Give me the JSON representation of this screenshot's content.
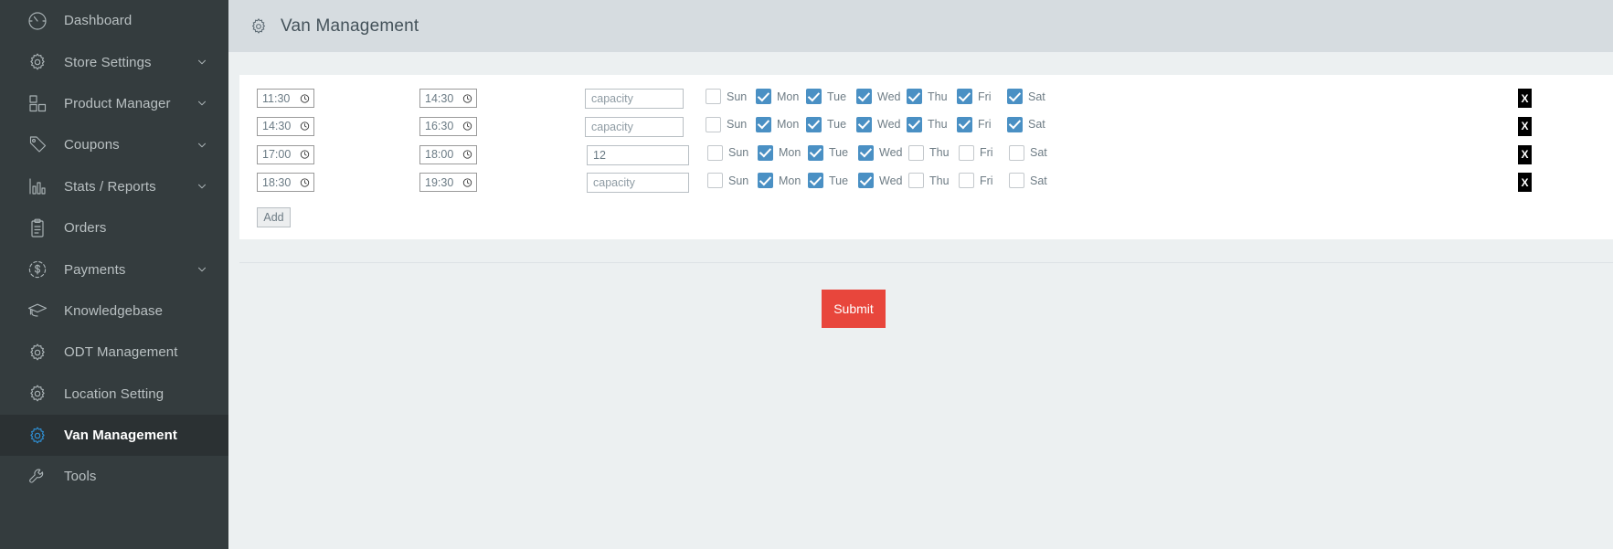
{
  "sidebar": {
    "items": [
      {
        "label": "Dashboard",
        "icon": "speedometer-icon",
        "chevron": false,
        "active": false
      },
      {
        "label": "Store Settings",
        "icon": "gear-icon",
        "chevron": true,
        "active": false
      },
      {
        "label": "Product Manager",
        "icon": "blocks-icon",
        "chevron": true,
        "active": false
      },
      {
        "label": "Coupons",
        "icon": "tag-icon",
        "chevron": true,
        "active": false
      },
      {
        "label": "Stats / Reports",
        "icon": "bar-chart-icon",
        "chevron": true,
        "active": false
      },
      {
        "label": "Orders",
        "icon": "clipboard-icon",
        "chevron": false,
        "active": false
      },
      {
        "label": "Payments",
        "icon": "dollar-circle-icon",
        "chevron": true,
        "active": false
      },
      {
        "label": "Knowledgebase",
        "icon": "graduation-cap-icon",
        "chevron": false,
        "active": false
      },
      {
        "label": "ODT Management",
        "icon": "gear-icon",
        "chevron": false,
        "active": false
      },
      {
        "label": "Location Setting",
        "icon": "gear-icon",
        "chevron": false,
        "active": false
      },
      {
        "label": "Van Management",
        "icon": "gear-icon",
        "chevron": false,
        "active": true
      },
      {
        "label": "Tools",
        "icon": "wrench-icon",
        "chevron": false,
        "active": false
      }
    ]
  },
  "header": {
    "title": "Van Management",
    "icon": "gear-icon"
  },
  "form": {
    "capacity_placeholder": "capacity",
    "day_labels": [
      "Sun",
      "Mon",
      "Tue",
      "Wed",
      "Thu",
      "Fri",
      "Sat"
    ],
    "rows": [
      {
        "start_time": "11:30",
        "end_time": "14:30",
        "capacity": "",
        "capacity_display": "capacity",
        "days": [
          false,
          true,
          true,
          true,
          true,
          true,
          true
        ],
        "delete_label": "X"
      },
      {
        "start_time": "14:30",
        "end_time": "16:30",
        "capacity": "",
        "capacity_display": "capacity",
        "days": [
          false,
          true,
          true,
          true,
          true,
          true,
          true
        ],
        "delete_label": "X"
      },
      {
        "start_time": "17:00",
        "end_time": "18:00",
        "capacity": "12",
        "capacity_display": "12",
        "days": [
          false,
          true,
          true,
          true,
          false,
          false,
          false
        ],
        "delete_label": "X"
      },
      {
        "start_time": "18:30",
        "end_time": "19:30",
        "capacity": "",
        "capacity_display": "capacity",
        "days": [
          false,
          true,
          true,
          true,
          false,
          false,
          false
        ],
        "delete_label": "X"
      }
    ],
    "add_label": "Add",
    "submit_label": "Submit"
  },
  "colors": {
    "sidebar_bg": "#343c3e",
    "sidebar_active_bg": "#2b3133",
    "accent_blue": "#4a90c4",
    "submit_red": "#e8463c",
    "topbar_bg": "#d6dce0",
    "page_bg": "#ecf0f1"
  }
}
